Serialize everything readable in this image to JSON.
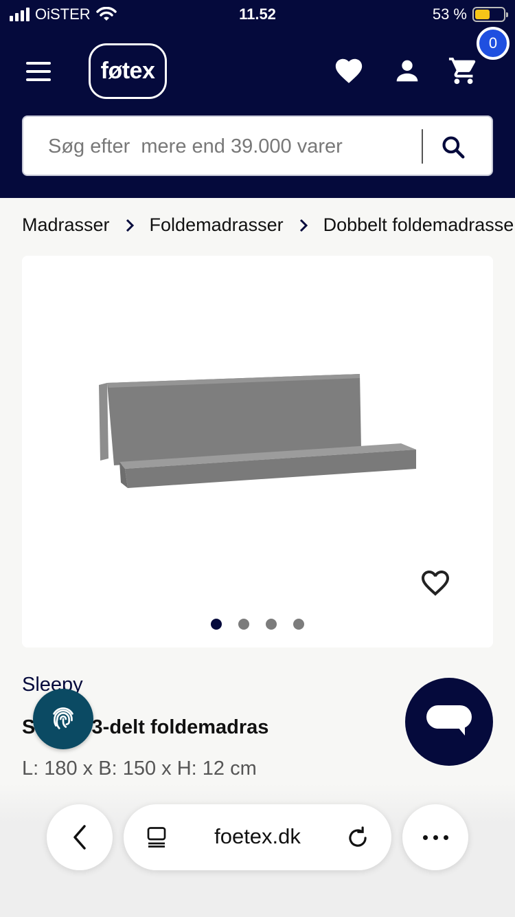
{
  "status_bar": {
    "carrier": "OiSTER",
    "time": "11.52",
    "battery": "53 %",
    "battery_level": 0.53,
    "battery_color": "#f5c518"
  },
  "header": {
    "logo": "føtex",
    "cart_count": "0",
    "icons": [
      "menu-icon",
      "heart-icon",
      "user-icon",
      "cart-icon"
    ],
    "brand_color": "#050a3c"
  },
  "search": {
    "placeholder": "Søg efter  mere end 39.000 varer"
  },
  "breadcrumb": {
    "items": [
      "Madrasser",
      "Foldemadrasser",
      "Dobbelt foldemadrasser"
    ]
  },
  "product": {
    "image_dots": 4,
    "active_dot": 0,
    "brand": "Sleepy",
    "title": "Sleepy 3-delt foldemadras",
    "dimensions": "L: 180 x B: 150 x H: 12 cm"
  },
  "browser": {
    "url": "foetex.dk"
  }
}
